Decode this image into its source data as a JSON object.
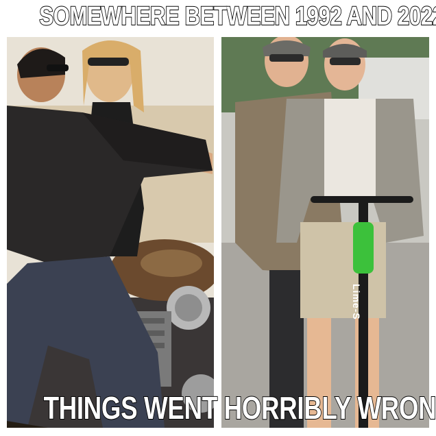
{
  "captions": {
    "top": "SOMEWHERE BETWEEN 1992 AND 2022",
    "bottom": "THINGS WENT HORRIBLY WRONG"
  },
  "scooter": {
    "brand": "Lime-S"
  },
  "colors": {
    "caption_fill": "#ffffff",
    "caption_stroke": "#000000",
    "scooter_green": "#3cc13b",
    "leather_jacket": "#2a2828",
    "tweed_jacket": "#8a7a63"
  }
}
